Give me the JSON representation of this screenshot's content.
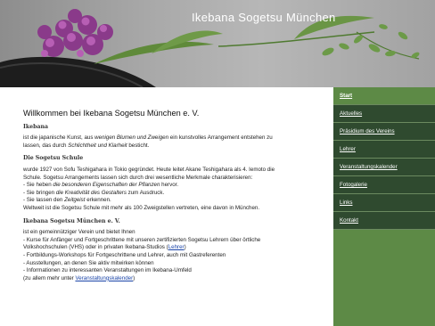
{
  "header": {
    "title": "Ikebana Sogetsu München"
  },
  "nav": {
    "items": [
      {
        "label": "Start",
        "active": true
      },
      {
        "label": "Aktuelles"
      },
      {
        "label": "Präsidium des Vereins"
      },
      {
        "label": "Lehrer"
      },
      {
        "label": "Veranstaltungskalender"
      },
      {
        "label": "Fotogalerie"
      },
      {
        "label": "Links"
      },
      {
        "label": "Kontakt"
      }
    ]
  },
  "content": {
    "heading": "Willkommen bei Ikebana Sogetsu München e. V.",
    "ikebana": {
      "title": "Ikebana",
      "l1_a": "ist die japanische Kunst, aus ",
      "l1_em": "wenigen Blumen und Zweigen",
      "l1_b": " ein kunstvolles Arrangement entstehen zu",
      "l2_a": "lassen, das durch ",
      "l2_em": "Schlichtheit und Klarheit",
      "l2_b": " besticht."
    },
    "schule": {
      "title": "Die Sogetsu Schule",
      "l1": "wurde 1927 von Sofu Teshigahara in Tokio gegründet. Heute leitet  Akane Teshigahara als 4. Iemoto die",
      "l2": "Schule. Sogetsu Arrangements lassen sich durch drei wesentliche Merkmale charakterisieren:",
      "b1_a": "- Sie heben ",
      "b1_em": "die besonderen Eigenschaften der Pflanzen",
      "b1_b": " hervor.",
      "b2_a": "- Sie bringen ",
      "b2_em": "die Kreativität des Gestalters",
      "b2_b": " zum Ausdruck.",
      "b3_a": "- Sie lassen den ",
      "b3_em": "Zeitgeist",
      "b3_b": " erkennen.",
      "l3": "Weltweit ist die Sogetsu Schule mit mehr als 100 Zweigstellen vertreten, eine davon in München."
    },
    "verein": {
      "title": "Ikebana Sogetsu München e. V.",
      "l1": "ist ein gemeinnütziger Verein und bietet Ihnen",
      "l2": "- Kurse für Anfänger und Fortgeschrittene mit unseren zertifizierten Sogetsu Lehrern über örtliche",
      "l3_a": "  Volkshochschulen (VHS) oder in privaten Ikebana-Studios (",
      "l3_link": "Lehrer",
      "l3_b": ")",
      "l4": "- Fortbildungs-Workshops für Fortgeschrittene und Lehrer, auch mit  Gastreferenten",
      "l5": "- Ausstellungen, an denen Sie aktiv mitwirken können",
      "l6": "- Informationen zu interessanten Veranstaltungen im Ikebana-Umfeld",
      "l7_a": "  (zu allem mehr unter ",
      "l7_link": "Veranstaltungskalender",
      "l7_b": ")"
    }
  }
}
